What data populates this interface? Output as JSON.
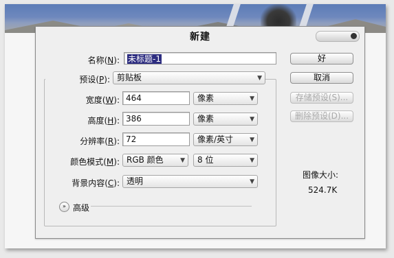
{
  "dialog": {
    "title": "新建",
    "name_label_pre": "名称(",
    "name_label_key": "N",
    "name_label_post": "):",
    "name_value": "未标题-1",
    "preset_label_pre": "预设(",
    "preset_label_key": "P",
    "preset_label_post": "):",
    "preset_value": "剪贴板",
    "width_label_pre": "宽度(",
    "width_label_key": "W",
    "width_label_post": "):",
    "width_value": "464",
    "width_unit": "像素",
    "height_label_pre": "高度(",
    "height_label_key": "H",
    "height_label_post": "):",
    "height_value": "386",
    "height_unit": "像素",
    "resolution_label_pre": "分辨率(",
    "resolution_label_key": "R",
    "resolution_label_post": "):",
    "resolution_value": "72",
    "resolution_unit": "像素/英寸",
    "colormode_label_pre": "颜色模式(",
    "colormode_label_key": "M",
    "colormode_label_post": "):",
    "colormode_value": "RGB 颜色",
    "bitdepth_value": "8 位",
    "background_label_pre": "背景内容(",
    "background_label_key": "C",
    "background_label_post": "):",
    "background_value": "透明",
    "advanced_label": "高级",
    "image_size_label": "图像大小:",
    "image_size_value": "524.7K"
  },
  "buttons": {
    "ok": "好",
    "cancel": "取消",
    "save_preset": "存储预设(S)...",
    "delete_preset": "删除预设(D)..."
  },
  "icons": {
    "dropdown": "chevron-down-icon",
    "advanced_toggle": "double-chevron-down-icon",
    "window_control": "window-control-icon"
  },
  "colors": {
    "selection": "#2d2d80",
    "dialog_bg": "#efefef"
  }
}
